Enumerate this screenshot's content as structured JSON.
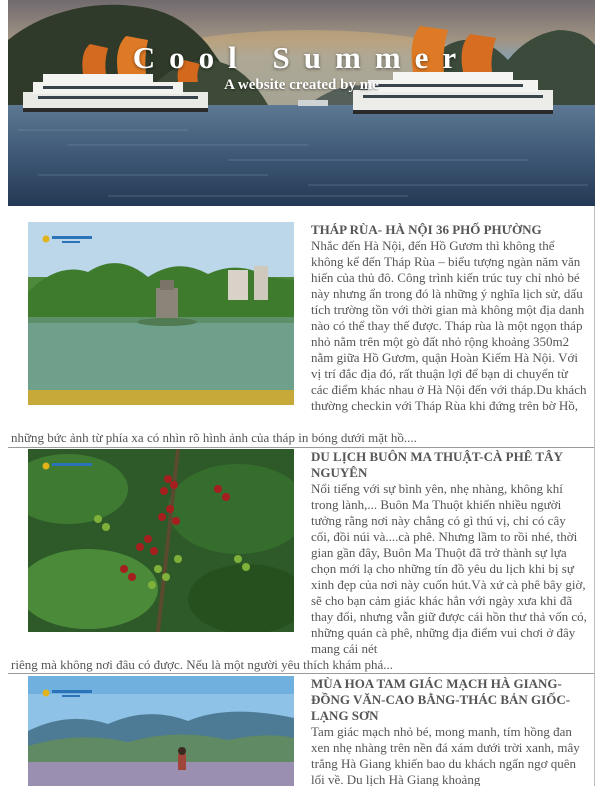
{
  "header": {
    "title": "Cool Summer",
    "subtitle": "A website created by me"
  },
  "articles": [
    {
      "title": "THÁP RÙA- HÀ NỘI 36 PHỐ PHƯỜNG",
      "desc_right": "Nhắc đến Hà Nội, đến Hồ Gươm thì không thể không kể đến Tháp Rùa – biểu tượng ngàn năm văn hiến của thủ đô. Công trình kiến trúc tuy chỉ nhỏ bé này nhưng ẩn trong đó là những ý nghĩa lịch sử, dấu tích trường tồn với thời gian mà không một địa danh nào có thể thay thế được. Tháp rùa là một ngọn tháp nhỏ nằm trên một gò đất nhỏ rộng khoảng 350m2 nằm giữa Hồ Gươm, quận Hoàn Kiếm Hà Nội. Với vị trí đắc địa đó, rất thuận lợi để bạn di chuyển từ các điểm khác nhau ở Hà Nội đến với tháp.Du khách thường checkin với Tháp Rùa khi đứng trên bờ Hồ,",
      "desc_full": "những bức ảnh từ phía xa có nhìn rõ hình ảnh của tháp in bóng dưới mặt hồ...."
    },
    {
      "title": "DU LỊCH BUÔN MA THUẬT-CÀ PHÊ TÂY NGUYÊN",
      "desc_right": "Nổi tiếng với sự bình yên, nhẹ nhàng, không khí trong lành,... Buôn Ma Thuột khiến nhiều người tưởng rằng nơi này chẳng có gì thú vị, chỉ có cây cối, đồi núi và....cà phê. Nhưng lầm to rồi nhé, thời gian gần đây, Buôn Ma Thuột đã trở thành sự lựa chọn mới lạ cho những tín đồ yêu du lịch khi bị sự xinh đẹp của nơi này cuốn hút.Và xứ cà phê bây giờ, sẽ cho bạn cảm giác khác hẳn với ngày xưa khi đã thay đổi, nhưng vẫn giữ được cái hồn thư thả vốn có, những quán cà phê, những địa điểm vui chơi ở đây mang cái nét",
      "desc_full": "riêng mà không nơi đâu có được. Nếu là một người yêu thích khám phá..."
    },
    {
      "title": "MÙA HOA TAM GIÁC MẠCH HÀ GIANG-ĐỒNG VĂN-CAO BẰNG-THÁC BẢN GIỐC-LẠNG SƠN",
      "desc_right": "Tam giác mạch nhỏ bé, mong manh, tím hồng đan xen nhẹ nhàng trên nền đá xám dưới trời xanh, mây trắng Hà Giang khiến bao du khách ngẩn ngơ quên lối về. Du lịch Hà Giang khoảng",
      "desc_full": ""
    }
  ],
  "colors": {
    "text": "#555555",
    "separator": "#9a9a9a",
    "hero_text": "#ffffff"
  }
}
